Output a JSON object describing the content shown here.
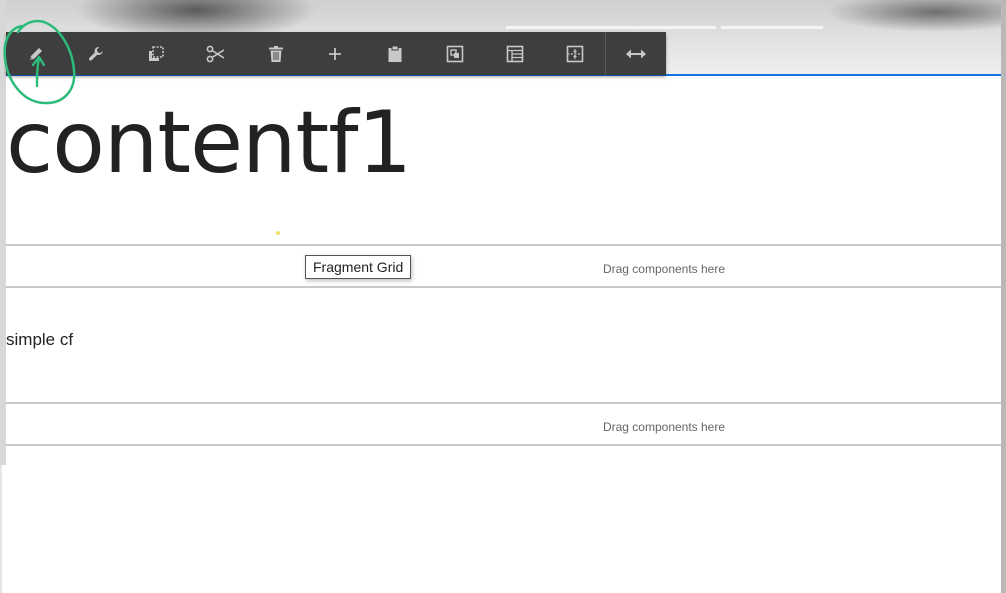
{
  "toolbar": {
    "tools": [
      {
        "name": "edit",
        "icon": "pencil-icon",
        "tooltip": ""
      },
      {
        "name": "configure",
        "icon": "wrench-icon",
        "tooltip": ""
      },
      {
        "name": "copy",
        "icon": "copy-icon",
        "tooltip": ""
      },
      {
        "name": "cut",
        "icon": "scissors-icon",
        "tooltip": ""
      },
      {
        "name": "delete",
        "icon": "trash-icon",
        "tooltip": ""
      },
      {
        "name": "insert",
        "icon": "plus-icon",
        "tooltip": ""
      },
      {
        "name": "paste",
        "icon": "clipboard-icon",
        "tooltip": ""
      },
      {
        "name": "group",
        "icon": "group-icon",
        "tooltip": ""
      },
      {
        "name": "layout",
        "icon": "layout-icon",
        "tooltip": ""
      },
      {
        "name": "split",
        "icon": "split-icon",
        "tooltip": ""
      },
      {
        "name": "resize",
        "icon": "double-arrow-icon",
        "tooltip": ""
      }
    ],
    "icon_color": "#c8c8c8",
    "background": "#3e3e3e"
  },
  "content": {
    "title": "contentf1",
    "dropzone_1": "Drag components here",
    "tooltip": "Fragment Grid",
    "fragment_text": "simple cf",
    "dropzone_2": "Drag components here"
  },
  "colors": {
    "accent_line": "#1473e6",
    "annotation": "#2dbb7a"
  }
}
